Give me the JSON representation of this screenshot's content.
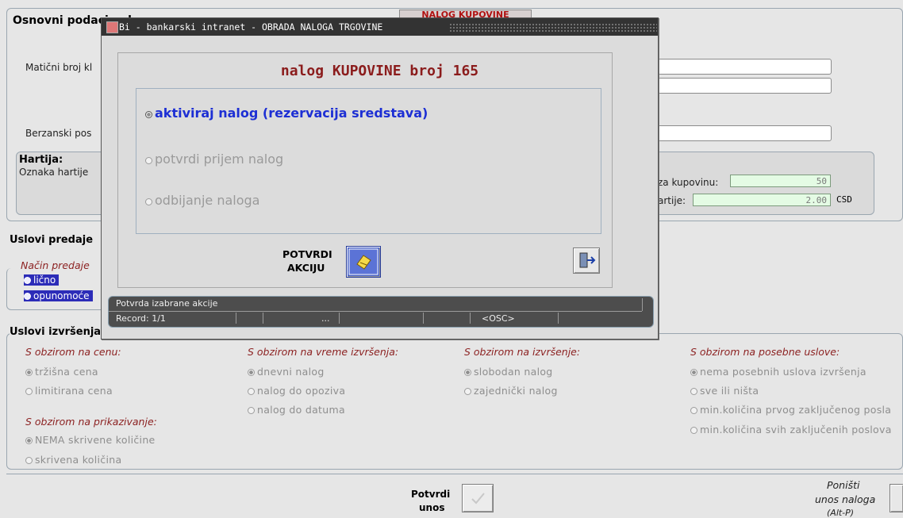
{
  "background_form": {
    "section_title": "Osnovni podaci naloga",
    "top_badge": "NALOG KUPOVINE",
    "maticni_label": "Matični broj kl",
    "berzanski_label": "Berzanski pos",
    "hartija": {
      "title": "Hartija:",
      "oznaka_label": "Oznaka hartije",
      "kolicina_label": "za kupovinu:",
      "kolicina_value": "50",
      "cena_label": "artije:",
      "cena_value": "2.00",
      "currency": "CSD"
    },
    "uslovi_predaje": {
      "title": "Uslovi predaje",
      "nacin_label": "Način predaje",
      "options": [
        "lično",
        "opunomoće"
      ]
    },
    "uslovi_izvrsenja": {
      "title": "Uslovi izvršenja",
      "col1": {
        "heading": "S obzirom na cenu:",
        "options": [
          "tržišna cena",
          "limitirana cena"
        ]
      },
      "col1b": {
        "heading": "S obzirom na prikazivanje:",
        "options": [
          "NEMA skrivene količine",
          "skrivena količina"
        ]
      },
      "col2": {
        "heading": "S obzirom na vreme izvršenja:",
        "options": [
          "dnevni nalog",
          "nalog do opoziva",
          "nalog do datuma"
        ]
      },
      "col3": {
        "heading": "S obzirom na izvršenje:",
        "options": [
          "slobodan nalog",
          "zajednički nalog"
        ]
      },
      "col4": {
        "heading": "S obzirom na posebne uslove:",
        "options": [
          "nema posebnih uslova izvršenja",
          "sve ili ništa",
          "min.količina prvog zaključenog posla",
          "min.količina svih zaključenih poslova"
        ]
      }
    },
    "potvrdi_unos": [
      "Potvrdi",
      "unos"
    ],
    "ponisti": [
      "Poništi",
      "unos naloga",
      "(Alt-P)"
    ]
  },
  "modal": {
    "title": "Bi - bankarski intranet - OBRADA NALOGA TRGOVINE",
    "heading": "nalog KUPOVINE broj 165",
    "options": [
      {
        "label": "aktiviraj nalog (rezervacija sredstava)",
        "selected": true
      },
      {
        "label": "potvrdi prijem nalog",
        "selected": false
      },
      {
        "label": "odbijanje naloga",
        "selected": false
      }
    ],
    "confirm_label": [
      "POTVRDI",
      "AKCIJU"
    ],
    "status_message": "Potvrda izabrane akcije",
    "record": "Record: 1/1",
    "ellipsis": "...",
    "mode": "<OSC>"
  },
  "colors": {
    "accent_blue": "#1d2fd4",
    "heading_red": "#8b1c1c",
    "disabled_gray": "#9a9a9a"
  }
}
